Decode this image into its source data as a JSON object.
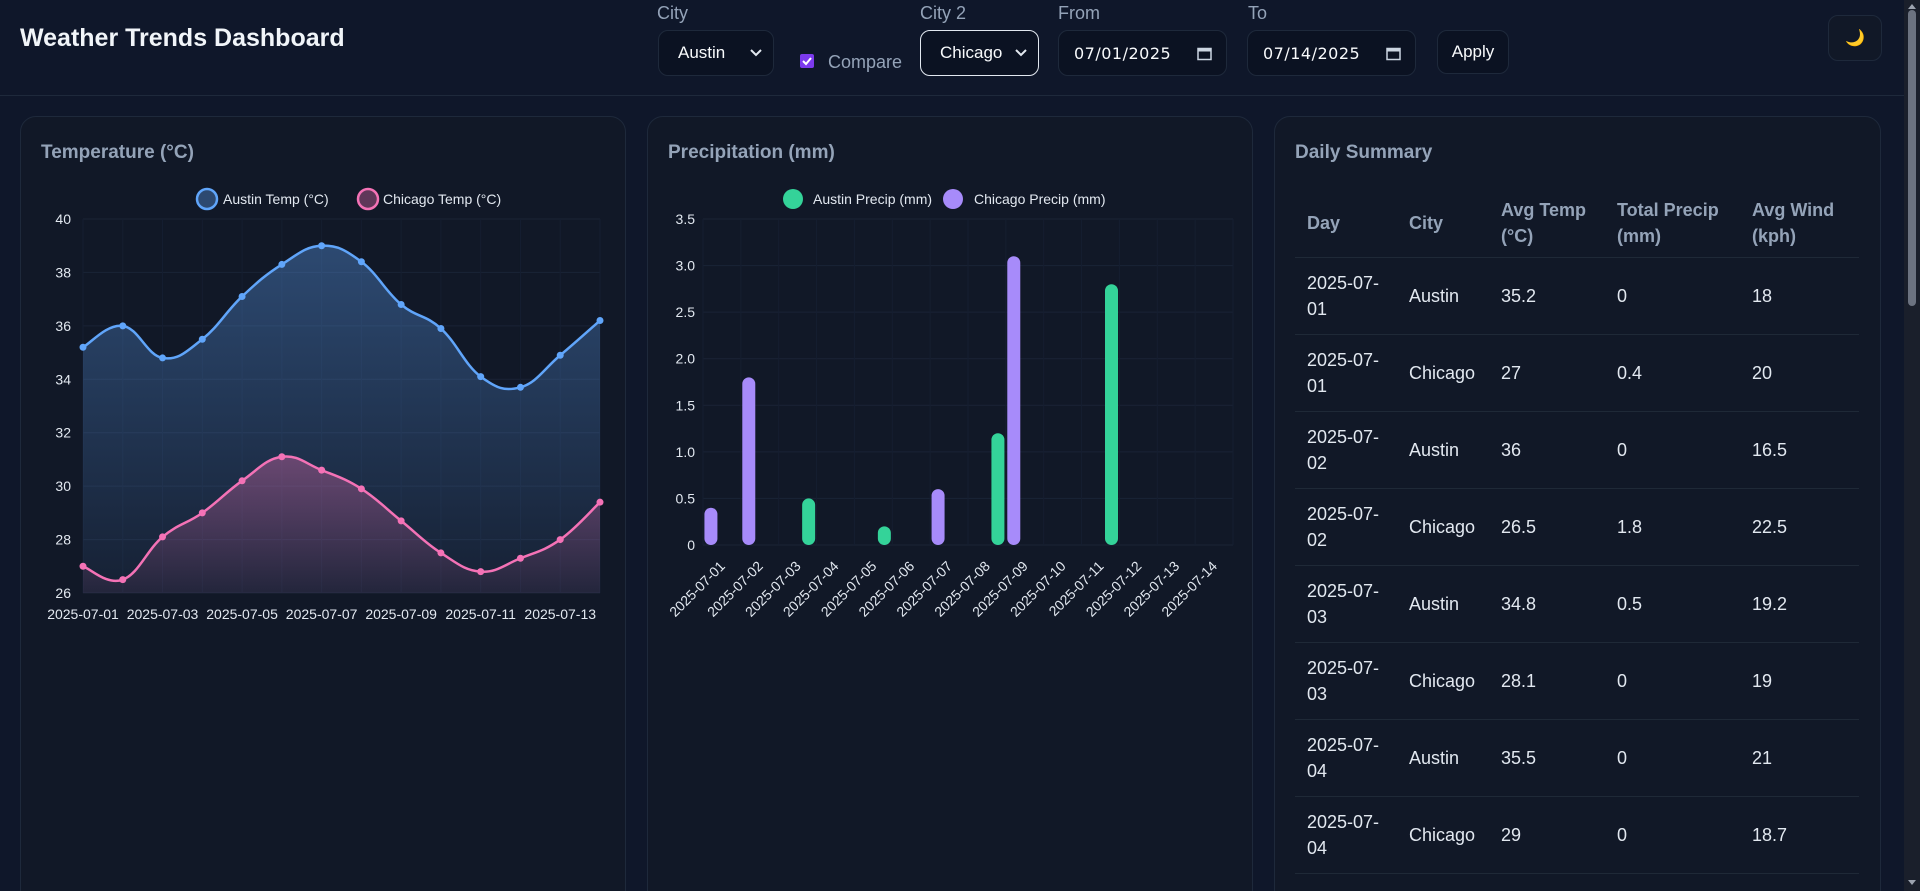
{
  "header": {
    "title": "Weather Trends Dashboard",
    "city_label": "City",
    "city_value": "Austin",
    "compare_label": "Compare",
    "compare_checked": true,
    "city2_label": "City 2",
    "city2_value": "Chicago",
    "from_label": "From",
    "from_value": "07/01/2025",
    "to_label": "To",
    "to_value": "07/14/2025",
    "apply_label": "Apply",
    "theme_icon": "moon-icon"
  },
  "temperature_card": {
    "title": "Temperature (°C)"
  },
  "precipitation_card": {
    "title": "Precipitation (mm)"
  },
  "summary_card": {
    "title": "Daily Summary",
    "columns": [
      [
        "Day"
      ],
      [
        "City"
      ],
      [
        "Avg Temp",
        "(°C)"
      ],
      [
        "Total Precip",
        "(mm)"
      ],
      [
        "Avg Wind",
        "(kph)"
      ]
    ],
    "rows": [
      {
        "day": [
          "2025-07-",
          "01"
        ],
        "city": "Austin",
        "temp": "35.2",
        "precip": "0",
        "wind": "18"
      },
      {
        "day": [
          "2025-07-",
          "01"
        ],
        "city": "Chicago",
        "temp": "27",
        "precip": "0.4",
        "wind": "20"
      },
      {
        "day": [
          "2025-07-",
          "02"
        ],
        "city": "Austin",
        "temp": "36",
        "precip": "0",
        "wind": "16.5"
      },
      {
        "day": [
          "2025-07-",
          "02"
        ],
        "city": "Chicago",
        "temp": "26.5",
        "precip": "1.8",
        "wind": "22.5"
      },
      {
        "day": [
          "2025-07-",
          "03"
        ],
        "city": "Austin",
        "temp": "34.8",
        "precip": "0.5",
        "wind": "19.2"
      },
      {
        "day": [
          "2025-07-",
          "03"
        ],
        "city": "Chicago",
        "temp": "28.1",
        "precip": "0",
        "wind": "19"
      },
      {
        "day": [
          "2025-07-",
          "04"
        ],
        "city": "Austin",
        "temp": "35.5",
        "precip": "0",
        "wind": "21"
      },
      {
        "day": [
          "2025-07-",
          "04"
        ],
        "city": "Chicago",
        "temp": "29",
        "precip": "0",
        "wind": "18.7"
      }
    ]
  },
  "chart_data": [
    {
      "type": "line",
      "title": "Temperature (°C)",
      "legend_position": "top",
      "x": [
        "2025-07-01",
        "2025-07-02",
        "2025-07-03",
        "2025-07-04",
        "2025-07-05",
        "2025-07-06",
        "2025-07-07",
        "2025-07-08",
        "2025-07-09",
        "2025-07-10",
        "2025-07-11",
        "2025-07-12",
        "2025-07-13",
        "2025-07-14"
      ],
      "x_tick_labels": [
        "2025-07-01",
        "2025-07-03",
        "2025-07-05",
        "2025-07-07",
        "2025-07-09",
        "2025-07-11",
        "2025-07-13"
      ],
      "ylim": [
        26,
        40
      ],
      "y_ticks": [
        26,
        28,
        30,
        32,
        34,
        36,
        38,
        40
      ],
      "grid": true,
      "series": [
        {
          "name": "Austin Temp (°C)",
          "color": "#60a5fa",
          "values": [
            35.2,
            36,
            34.8,
            35.5,
            37.1,
            38.3,
            39,
            38.4,
            36.8,
            35.9,
            34.1,
            33.7,
            34.9,
            36.2
          ]
        },
        {
          "name": "Chicago Temp (°C)",
          "color": "#f472b6",
          "values": [
            27,
            26.5,
            28.1,
            29,
            30.2,
            31.1,
            30.6,
            29.9,
            28.7,
            27.5,
            26.8,
            27.3,
            28,
            29.4
          ]
        }
      ]
    },
    {
      "type": "bar",
      "title": "Precipitation (mm)",
      "legend_position": "top",
      "categories": [
        "2025-07-01",
        "2025-07-02",
        "2025-07-03",
        "2025-07-04",
        "2025-07-05",
        "2025-07-06",
        "2025-07-07",
        "2025-07-08",
        "2025-07-09",
        "2025-07-10",
        "2025-07-11",
        "2025-07-12",
        "2025-07-13",
        "2025-07-14"
      ],
      "ylim": [
        0,
        3.5
      ],
      "y_ticks": [
        "0",
        "0.5",
        "1.0",
        "1.5",
        "2.0",
        "2.5",
        "3.0",
        "3.5"
      ],
      "grid": true,
      "series": [
        {
          "name": "Austin Precip (mm)",
          "color": "#34d399",
          "values": [
            0,
            0,
            0.5,
            0,
            0.2,
            0,
            0,
            1.2,
            0,
            0,
            2.8,
            0,
            0,
            0
          ]
        },
        {
          "name": "Chicago Precip (mm)",
          "color": "#a78bfa",
          "values": [
            0.4,
            1.8,
            0,
            0,
            0,
            0,
            0.6,
            0,
            3.1,
            0,
            0,
            0,
            0,
            0
          ]
        }
      ]
    }
  ]
}
